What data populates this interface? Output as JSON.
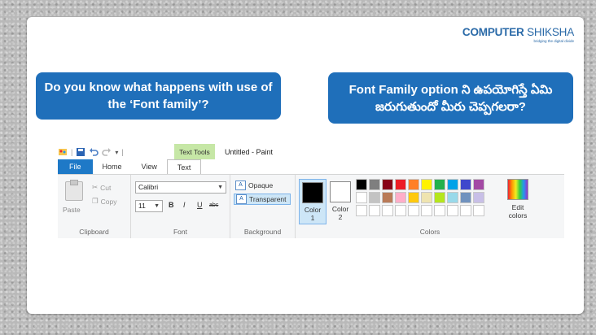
{
  "logo": {
    "name_bold": "COMPUTER",
    "name_rest": " SHIKSHA",
    "tagline": "bridging the digital divide"
  },
  "bubbles": {
    "english": "Do you know what happens with use of the ‘Font family’?",
    "telugu": "Font Family option ని ఉపయోగిస్తే ఏమి జరుగుతుందో మీరు చెప్పగలరా?"
  },
  "ribbon": {
    "contextual_tab": "Text Tools",
    "window_title": "Untitled - Paint",
    "tabs": [
      "File",
      "Home",
      "View",
      "Text"
    ],
    "clipboard": {
      "paste": "Paste",
      "cut": "Cut",
      "copy": "Copy",
      "label": "Clipboard"
    },
    "font": {
      "family": "Calibri",
      "size": "11",
      "bold": "B",
      "italic": "I",
      "underline": "U",
      "strikethrough": "abc",
      "label": "Font"
    },
    "background": {
      "opaque": "Opaque",
      "transparent": "Transparent",
      "label": "Background"
    },
    "colors": {
      "color1_label": "Color 1",
      "color1_line1": "Color",
      "color1_line2": "1",
      "color2_line1": "Color",
      "color2_line2": "2",
      "color1_value": "#000000",
      "color2_value": "#ffffff",
      "edit_line1": "Edit",
      "edit_line2": "colors",
      "label": "Colors",
      "palette": [
        "#000000",
        "#7f7f7f",
        "#880015",
        "#ed1c24",
        "#ff7f27",
        "#fff200",
        "#22b14c",
        "#00a2e8",
        "#3f48cc",
        "#a349a4",
        "#ffffff",
        "#c3c3c3",
        "#b97a57",
        "#ffaec9",
        "#ffc90e",
        "#efe4b0",
        "#b5e61d",
        "#99d9ea",
        "#7092be",
        "#c8bfe7",
        "#ffffff",
        "#ffffff",
        "#ffffff",
        "#ffffff",
        "#ffffff",
        "#ffffff",
        "#ffffff",
        "#ffffff",
        "#ffffff",
        "#ffffff"
      ]
    }
  },
  "colors": {
    "accent": "#1f6fba",
    "file_tab": "#1e79c7",
    "text_tools": "#c6e7a6"
  }
}
